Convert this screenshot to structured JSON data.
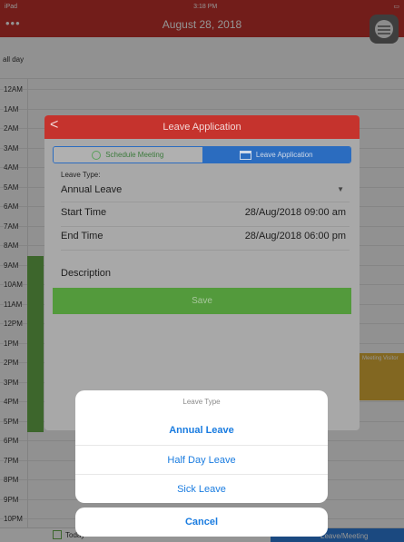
{
  "status_bar": {
    "device": "iPad",
    "time": "3:18 PM",
    "battery": ""
  },
  "nav": {
    "more": "•••",
    "date_title": "August 28, 2018"
  },
  "calendar": {
    "allday_label": "all day",
    "hours": [
      "12AM",
      "1AM",
      "2AM",
      "3AM",
      "4AM",
      "5AM",
      "6AM",
      "7AM",
      "8AM",
      "9AM",
      "10AM",
      "11AM",
      "12PM",
      "1PM",
      "2PM",
      "3PM",
      "4PM",
      "5PM",
      "6PM",
      "7PM",
      "8PM",
      "9PM",
      "10PM"
    ],
    "yellow_event": "Meeting Visitor"
  },
  "bottom_tabs": {
    "left": "Today",
    "right": "Leave/Meeting"
  },
  "modal": {
    "title": "Leave Application",
    "back": "<",
    "segments": {
      "left": "Schedule Meeting",
      "right": "Leave Application"
    },
    "leave_type_label": "Leave Type:",
    "leave_type_value": "Annual Leave",
    "start_label": "Start Time",
    "start_value": "28/Aug/2018 09:00 am",
    "end_label": "End Time",
    "end_value": "28/Aug/2018 06:00 pm",
    "description_label": "Description",
    "save_label": "Save"
  },
  "action_sheet": {
    "title": "Leave Type",
    "options": [
      "Annual Leave",
      "Half Day Leave",
      "Sick Leave"
    ],
    "cancel": "Cancel"
  },
  "colors": {
    "header_red": "#c5332d",
    "segment_blue": "#2b6cbf",
    "save_green": "#539a3c",
    "action_blue": "#1a7ce0"
  }
}
